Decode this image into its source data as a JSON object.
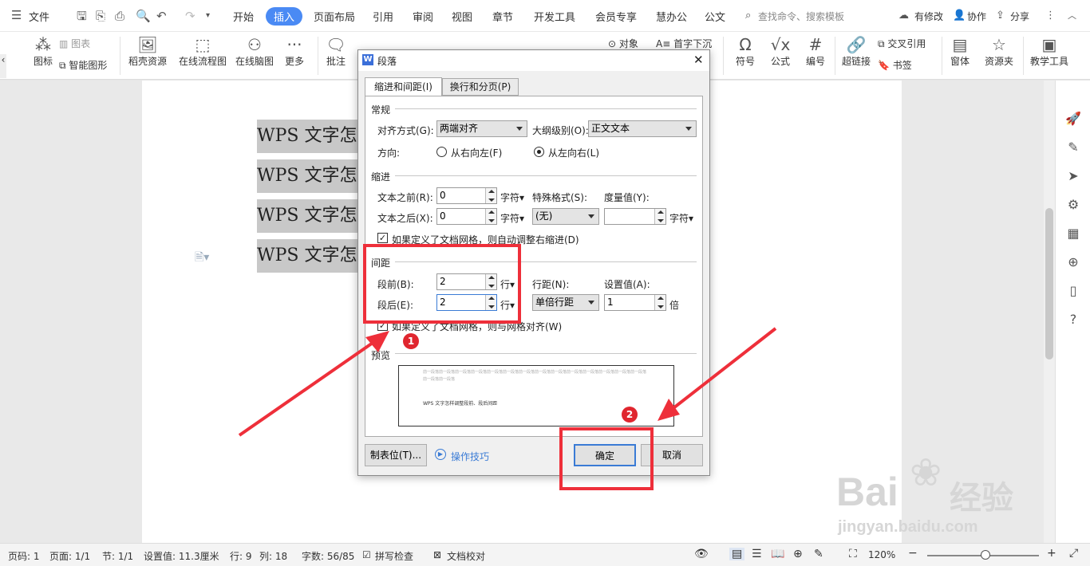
{
  "tabs": {
    "file": "文件",
    "items": [
      "开始",
      "插入",
      "页面布局",
      "引用",
      "审阅",
      "视图",
      "章节",
      "开发工具",
      "会员专享",
      "慧办公",
      "公文"
    ],
    "search": "查找命令、搜索模板",
    "modify": "有修改",
    "collab": "协作",
    "share": "分享"
  },
  "ribbon": {
    "chart": "图表",
    "icon": "图标",
    "smart": "智能图形",
    "daoke": "稻壳资源",
    "flow": "在线流程图",
    "mind": "在线脑图",
    "more": "更多",
    "comment": "批注",
    "object": "对象",
    "dropcap": "首字下沉",
    "symbol": "符号",
    "formula": "公式",
    "number": "编号",
    "hyperlink": "超链接",
    "crossref": "交叉引用",
    "bookmark": "书签",
    "window": "窗体",
    "resource": "资源夹",
    "teach": "教学工具"
  },
  "doc": {
    "lines": [
      "WPS 文字怎",
      "WPS 文字怎",
      "WPS 文字怎",
      "WPS 文字怎"
    ]
  },
  "dialog": {
    "title": "段落",
    "tab1": "缩进和间距(I)",
    "tab2": "换行和分页(P)",
    "general": "常规",
    "align_label": "对齐方式(G):",
    "align_value": "两端对齐",
    "outline_label": "大纲级别(O):",
    "outline_value": "正文文本",
    "direction_label": "方向:",
    "rtl": "从右向左(F)",
    "ltr": "从左向右(L)",
    "indent": "缩进",
    "before_text_label": "文本之前(R):",
    "before_text_value": "0",
    "after_text_label": "文本之后(X):",
    "after_text_value": "0",
    "unit_char": "字符",
    "special_label": "特殊格式(S):",
    "special_value": "(无)",
    "measure_label": "度量值(Y):",
    "measure_value": "",
    "grid_indent": "如果定义了文档网格，则自动调整右缩进(D)",
    "spacing": "间距",
    "before_label": "段前(B):",
    "before_value": "2",
    "after_label": "段后(E):",
    "after_value": "2",
    "unit_line": "行",
    "line_spacing_label": "行距(N):",
    "line_spacing_value": "单倍行距",
    "setting_label": "设置值(A):",
    "setting_value": "1",
    "unit_times": "倍",
    "grid_align": "如果定义了文档网格，则与网格对齐(W)",
    "preview": "预览",
    "preview_prev": "前一段落前一段落前一段落前一段落前一段落前一段落前一段落前一段落前一段落前一段落前一段落前一段落前一段落前一段落前一段落前一段落",
    "preview_text": "WPS 文字怎样调整段前、段后间距",
    "tabstops": "制表位(T)...",
    "tips": "操作技巧",
    "ok": "确定",
    "cancel": "取消"
  },
  "annotations": {
    "badge1": "1",
    "badge2": "2",
    "accent": "#ee2f3a"
  },
  "status": {
    "page": "页码: 1",
    "pages": "页面: 1/1",
    "section": "节: 1/1",
    "setting": "设置值: 11.3厘米",
    "row": "行: 9",
    "col": "列: 18",
    "words": "字数: 56/85",
    "spell": "拼写检查",
    "proof": "文档校对",
    "zoom": "120%"
  },
  "watermark": {
    "brand": "Bai",
    "brand2": "经验",
    "url": "jingyan.baidu.com"
  }
}
